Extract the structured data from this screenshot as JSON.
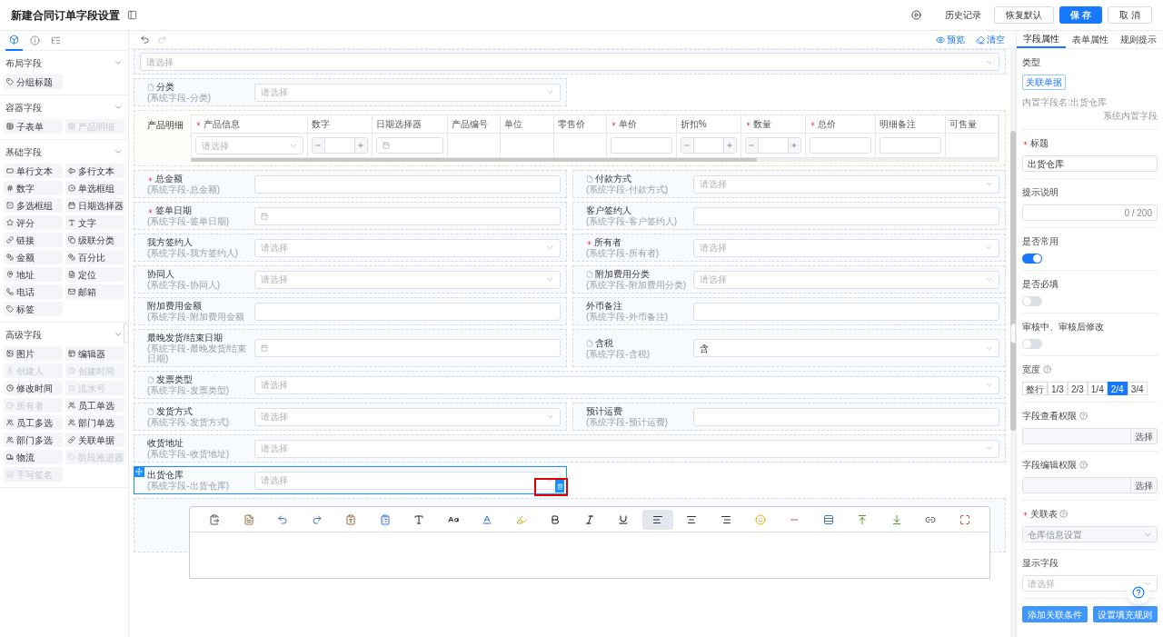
{
  "header": {
    "title": "新建合同订单字段设置",
    "history": "历史记录",
    "buttons": [
      {
        "label": "恢复默认",
        "kind": "default"
      },
      {
        "label": "保 存",
        "kind": "primary"
      },
      {
        "label": "取 消",
        "kind": "default"
      }
    ]
  },
  "left_panel": {
    "tabs": [
      {
        "kind": "components",
        "selected": true
      },
      {
        "kind": "info",
        "selected": false
      },
      {
        "kind": "tree",
        "selected": false
      }
    ],
    "sections": [
      {
        "title": "布局字段",
        "expanded": true,
        "items": [
          {
            "label": "分组标题",
            "kind": "group_title",
            "disabled": false
          }
        ]
      },
      {
        "title": "容器字段",
        "expanded": true,
        "items": [
          {
            "label": "子表单",
            "kind": "table",
            "disabled": false
          },
          {
            "label": "产品明细",
            "kind": "table",
            "disabled": true
          }
        ]
      },
      {
        "title": "基础字段",
        "expanded": true,
        "items": [
          {
            "label": "单行文本",
            "kind": "single_line",
            "disabled": false
          },
          {
            "label": "多行文本",
            "kind": "multi_line",
            "disabled": false
          },
          {
            "label": "数字",
            "kind": "number",
            "disabled": false
          },
          {
            "label": "单选框组",
            "kind": "radio",
            "disabled": false
          },
          {
            "label": "多选框组",
            "kind": "checkbox",
            "disabled": false
          },
          {
            "label": "日期选择器",
            "kind": "date",
            "disabled": false
          },
          {
            "label": "评分",
            "kind": "rating",
            "disabled": false
          },
          {
            "label": "文字",
            "kind": "text",
            "disabled": false
          },
          {
            "label": "链接",
            "kind": "link",
            "disabled": false
          },
          {
            "label": "级联分类",
            "kind": "cascade",
            "disabled": false
          },
          {
            "label": "金额",
            "kind": "amount",
            "disabled": false
          },
          {
            "label": "百分比",
            "kind": "amount",
            "disabled": false
          },
          {
            "label": "地址",
            "kind": "address",
            "disabled": false
          },
          {
            "label": "定位",
            "kind": "location",
            "disabled": false
          },
          {
            "label": "电话",
            "kind": "phone",
            "disabled": false
          },
          {
            "label": "邮箱",
            "kind": "email",
            "disabled": false
          },
          {
            "label": "标签",
            "kind": "tag",
            "disabled": false
          }
        ]
      },
      {
        "title": "高级字段",
        "expanded": true,
        "items": [
          {
            "label": "图片",
            "kind": "image",
            "disabled": false
          },
          {
            "label": "编辑器",
            "kind": "editor",
            "disabled": false
          },
          {
            "label": "创建人",
            "kind": "user",
            "disabled": true
          },
          {
            "label": "创建时间",
            "kind": "clock",
            "disabled": true
          },
          {
            "label": "修改时间",
            "kind": "clock",
            "disabled": false
          },
          {
            "label": "流水号",
            "kind": "serial",
            "disabled": true
          },
          {
            "label": "所有者",
            "kind": "clock",
            "disabled": true
          },
          {
            "label": "员工单选",
            "kind": "users",
            "disabled": false
          },
          {
            "label": "员工多选",
            "kind": "users",
            "disabled": false
          },
          {
            "label": "部门单选",
            "kind": "users",
            "disabled": false
          },
          {
            "label": "部门多选",
            "kind": "users",
            "disabled": false
          },
          {
            "label": "关联单据",
            "kind": "link",
            "disabled": false
          },
          {
            "label": "物流",
            "kind": "truck",
            "disabled": false
          },
          {
            "label": "阶段推进器",
            "kind": "group_title",
            "disabled": true
          },
          {
            "label": "手写签名",
            "kind": "signature",
            "disabled": true
          }
        ]
      }
    ]
  },
  "canvas": {
    "history_buttons": [
      {
        "kind": "undo",
        "disabled": false
      },
      {
        "kind": "redo",
        "disabled": true
      }
    ],
    "preview": "预览",
    "clear": "清空",
    "rows": [
      {
        "kind": "full",
        "fields": [
          {
            "kind": "select",
            "placeholder": "请选择",
            "selected": false
          }
        ]
      },
      {
        "kind": "half",
        "fields": [
          {
            "label": "分类",
            "sublabel": "(系统字段-分类)",
            "kind": "select",
            "placeholder": "请选择",
            "required": false,
            "doc_icon": true,
            "selected": false
          }
        ]
      },
      {
        "kind": "table",
        "label": "产品明细",
        "columns": [
          {
            "title": "产品信息",
            "required": true,
            "kind": "select",
            "placeholder": "请选择"
          },
          {
            "title": "数字",
            "required": false,
            "kind": "stepper"
          },
          {
            "title": "日期选择器",
            "required": false,
            "kind": "date"
          },
          {
            "title": "产品编号",
            "required": false,
            "kind": "empty"
          },
          {
            "title": "单位",
            "required": false,
            "kind": "empty"
          },
          {
            "title": "零售价",
            "required": false,
            "kind": "empty"
          },
          {
            "title": "单价",
            "required": true,
            "kind": "input"
          },
          {
            "title": "折扣%",
            "required": false,
            "kind": "stepper"
          },
          {
            "title": "数量",
            "required": true,
            "kind": "stepper"
          },
          {
            "title": "总价",
            "required": true,
            "kind": "input"
          },
          {
            "title": "明细备注",
            "required": false,
            "kind": "input"
          },
          {
            "title": "可售量",
            "required": false,
            "kind": "empty"
          }
        ]
      },
      {
        "kind": "half",
        "fields": [
          {
            "label": "总金额",
            "sublabel": "(系统字段-总金额)",
            "kind": "text",
            "required": true,
            "doc_icon": false,
            "selected": false
          },
          {
            "label": "付款方式",
            "sublabel": "(系统字段-付款方式)",
            "kind": "select",
            "placeholder": "请选择",
            "required": false,
            "doc_icon": true,
            "selected": false
          }
        ]
      },
      {
        "kind": "half",
        "fields": [
          {
            "label": "签单日期",
            "sublabel": "(系统字段-签单日期)",
            "kind": "date",
            "required": true,
            "doc_icon": false,
            "selected": false
          },
          {
            "label": "客户签约人",
            "sublabel": "(系统字段-客户签约人)",
            "kind": "text",
            "required": false,
            "doc_icon": false,
            "selected": false
          }
        ]
      },
      {
        "kind": "half",
        "fields": [
          {
            "label": "我方签约人",
            "sublabel": "(系统字段-我方签约人)",
            "kind": "select",
            "placeholder": "请选择",
            "required": false,
            "doc_icon": false,
            "selected": false
          },
          {
            "label": "所有者",
            "sublabel": "(系统字段-所有者)",
            "kind": "select",
            "placeholder": "请选择",
            "required": true,
            "doc_icon": false,
            "selected": false
          }
        ]
      },
      {
        "kind": "half",
        "fields": [
          {
            "label": "协同人",
            "sublabel": "(系统字段-协同人)",
            "kind": "select",
            "placeholder": "请选择",
            "required": false,
            "doc_icon": false,
            "selected": false
          },
          {
            "label": "附加费用分类",
            "sublabel": "(系统字段-附加费用分类)",
            "kind": "select",
            "placeholder": "请选择",
            "required": false,
            "doc_icon": true,
            "selected": false
          }
        ]
      },
      {
        "kind": "half",
        "fields": [
          {
            "label": "附加费用金额",
            "sublabel": "(系统字段-附加费用金额",
            "kind": "text",
            "required": false,
            "doc_icon": false,
            "selected": false
          },
          {
            "label": "外币备注",
            "sublabel": "(系统字段-外币备注)",
            "kind": "text",
            "required": false,
            "doc_icon": false,
            "selected": false
          }
        ]
      },
      {
        "kind": "half",
        "fields": [
          {
            "label": "最晚发货/结束日期",
            "sublabel": "(系统字段-最晚发货/结束日期)",
            "kind": "date",
            "required": false,
            "doc_icon": false,
            "selected": false
          },
          {
            "label": "含税",
            "sublabel": "(系统字段-含税)",
            "kind": "select",
            "value": "含",
            "required": false,
            "doc_icon": true,
            "selected": false
          }
        ]
      },
      {
        "kind": "full",
        "fields": [
          {
            "label": "发票类型",
            "sublabel": "(系统字段-发票类型)",
            "kind": "select",
            "placeholder": "请选择",
            "required": false,
            "doc_icon": true,
            "selected": false
          }
        ]
      },
      {
        "kind": "half",
        "fields": [
          {
            "label": "发货方式",
            "sublabel": "(系统字段-发货方式)",
            "kind": "select",
            "placeholder": "请选择",
            "required": false,
            "doc_icon": true,
            "selected": false
          },
          {
            "label": "预计运费",
            "sublabel": "(系统字段-预计运费)",
            "kind": "text",
            "required": false,
            "doc_icon": false,
            "selected": false
          }
        ]
      },
      {
        "kind": "full",
        "fields": [
          {
            "label": "收货地址",
            "sublabel": "(系统字段-收货地址)",
            "kind": "select",
            "placeholder": "请选择",
            "required": false,
            "doc_icon": false,
            "selected": false
          }
        ]
      },
      {
        "kind": "half",
        "fields": [
          {
            "label": "出货仓库",
            "sublabel": "(系统字段-出货仓库)",
            "kind": "select",
            "placeholder": "请选择",
            "required": false,
            "doc_icon": false,
            "selected": true,
            "annotated": true
          }
        ]
      },
      {
        "kind": "editor",
        "tools": [
          {
            "kind": "paste",
            "selected": false
          },
          {
            "kind": "template",
            "selected": false
          },
          {
            "kind": "undo",
            "selected": false
          },
          {
            "kind": "redo",
            "selected": false
          },
          {
            "kind": "paste_text",
            "selected": false
          },
          {
            "kind": "paste_word",
            "selected": false
          },
          {
            "kind": "font_family",
            "selected": false
          },
          {
            "kind": "font_size",
            "selected": false
          },
          {
            "kind": "font_color",
            "selected": false
          },
          {
            "kind": "highlight",
            "selected": false
          },
          {
            "kind": "bold",
            "selected": false
          },
          {
            "kind": "italic",
            "selected": false
          },
          {
            "kind": "underline",
            "selected": false
          },
          {
            "kind": "align_left",
            "selected": true
          },
          {
            "kind": "align_center",
            "selected": false
          },
          {
            "kind": "align_right",
            "selected": false
          },
          {
            "kind": "emoji",
            "selected": false
          },
          {
            "kind": "rule",
            "selected": false
          },
          {
            "kind": "table",
            "selected": false
          },
          {
            "kind": "row_above",
            "selected": false
          },
          {
            "kind": "row_below",
            "selected": false
          },
          {
            "kind": "link",
            "selected": false
          },
          {
            "kind": "fullscreen",
            "selected": false
          }
        ]
      }
    ]
  },
  "right_panel": {
    "tabs": [
      {
        "label": "字段属性",
        "selected": true
      },
      {
        "label": "表单属性",
        "selected": false
      },
      {
        "label": "规则提示",
        "selected": false
      }
    ],
    "type": {
      "label": "类型",
      "tag": "关联单据",
      "builtin_name": "内置字段名:出货仓库",
      "builtin_note": "系统内置字段"
    },
    "title_field": {
      "label": "标题",
      "required": true,
      "value": "出货仓库"
    },
    "hint": {
      "label": "提示说明",
      "counter": "0 / 200"
    },
    "toggles": [
      {
        "label": "是否常用",
        "on": true
      },
      {
        "label": "是否必填",
        "on": false
      },
      {
        "label": "审核中、审核后修改",
        "on": false
      }
    ],
    "width": {
      "label": "宽度",
      "options": [
        {
          "label": "整行",
          "selected": false
        },
        {
          "label": "1/3",
          "selected": false
        },
        {
          "label": "2/3",
          "selected": false
        },
        {
          "label": "1/4",
          "selected": false
        },
        {
          "label": "2/4",
          "selected": true
        },
        {
          "label": "3/4",
          "selected": false
        }
      ]
    },
    "permissions": [
      {
        "label": "字段查看权限",
        "button": "选择"
      },
      {
        "label": "字段编辑权限",
        "button": "选择"
      }
    ],
    "related_table": {
      "label": "关联表",
      "required": true,
      "value": "仓库信息设置",
      "disabled": true
    },
    "display_field": {
      "label": "显示字段",
      "placeholder": "请选择"
    },
    "buttons": [
      "添加关联条件",
      "设置填充规则"
    ]
  }
}
